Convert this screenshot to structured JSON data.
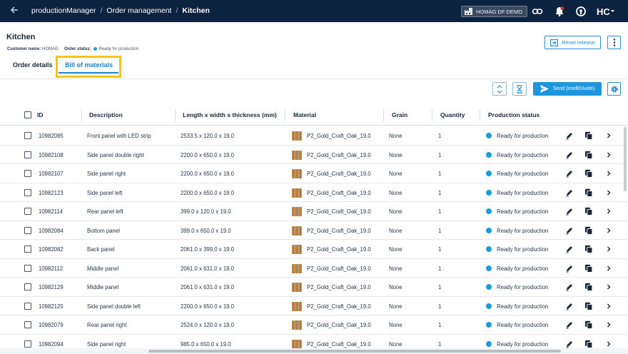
{
  "topbar": {
    "breadcrumbs": [
      "productionManager",
      "Order management",
      "Kitchen"
    ],
    "environment": "HOMAG DF DEMO",
    "icons": [
      "back-arrow-icon",
      "factory-icon",
      "link-icon",
      "notifications-icon",
      "support-icon",
      "user-menu-icon"
    ]
  },
  "page": {
    "title": "Kitchen",
    "customer_label": "Customer name:",
    "customer_value": "HOMAG",
    "status_label": "Order status:",
    "status_value": "Ready for production",
    "reset_label": "Reset release"
  },
  "tabs": [
    {
      "label": "Order details",
      "active": false
    },
    {
      "label": "Bill of materials",
      "active": true
    }
  ],
  "toolbar": {
    "send_label": "Send (intelliDivide)"
  },
  "table": {
    "columns": [
      "ID",
      "Description",
      "Length x width x thickness (mm)",
      "Material",
      "Grain",
      "Quantity",
      "Production status"
    ],
    "rows": [
      {
        "id": "10982085",
        "description": "Front panel with LED strip",
        "dims": "2533.5 x 120.0 x 19.0",
        "material": "P2_Gold_Craft_Oak_19.0",
        "grain": "None",
        "qty": "1",
        "status": "Ready for production"
      },
      {
        "id": "10982108",
        "description": "Side panel double right",
        "dims": "2200.0 x 650.0 x 19.0",
        "material": "P2_Gold_Craft_Oak_19.0",
        "grain": "None",
        "qty": "1",
        "status": "Ready for production"
      },
      {
        "id": "10982107",
        "description": "Side panel right",
        "dims": "2200.0 x 650.0 x 19.0",
        "material": "P2_Gold_Craft_Oak_19.0",
        "grain": "None",
        "qty": "1",
        "status": "Ready for production"
      },
      {
        "id": "10982123",
        "description": "Side panel left",
        "dims": "2200.0 x 650.0 x 19.0",
        "material": "P2_Gold_Craft_Oak_19.0",
        "grain": "None",
        "qty": "1",
        "status": "Ready for production"
      },
      {
        "id": "10982114",
        "description": "Rear panel left",
        "dims": "399.0 x 120.0 x 19.0",
        "material": "P2_Gold_Craft_Oak_19.0",
        "grain": "None",
        "qty": "1",
        "status": "Ready for production"
      },
      {
        "id": "10982084",
        "description": "Bottom panel",
        "dims": "399.0 x 650.0 x 19.0",
        "material": "P2_Gold_Craft_Oak_19.0",
        "grain": "None",
        "qty": "1",
        "status": "Ready for production"
      },
      {
        "id": "10982082",
        "description": "Back panel",
        "dims": "2061.0 x 399.0 x 19.0",
        "material": "P2_Gold_Craft_Oak_19.0",
        "grain": "None",
        "qty": "1",
        "status": "Ready for production"
      },
      {
        "id": "10982112",
        "description": "Middle panel",
        "dims": "2061.0 x 631.0 x 19.0",
        "material": "P2_Gold_Craft_Oak_19.0",
        "grain": "None",
        "qty": "1",
        "status": "Ready for production"
      },
      {
        "id": "10982129",
        "description": "Middle panel",
        "dims": "2061.0 x 631.0 x 19.0",
        "material": "P2_Gold_Craft_Oak_19.0",
        "grain": "None",
        "qty": "1",
        "status": "Ready for production"
      },
      {
        "id": "10982125",
        "description": "Side panel double left",
        "dims": "2200.0 x 650.0 x 19.0",
        "material": "P2_Gold_Craft_Oak_19.0",
        "grain": "None",
        "qty": "1",
        "status": "Ready for production"
      },
      {
        "id": "10982079",
        "description": "Rear panel right",
        "dims": "2524.0 x 120.0 x 19.0",
        "material": "P2_Gold_Craft_Oak_19.0",
        "grain": "None",
        "qty": "1",
        "status": "Ready for production"
      },
      {
        "id": "10982094",
        "description": "Side panel right",
        "dims": "985.0 x 650.0 x 19.0",
        "material": "P2_Gold_Craft_Oak_19.0",
        "grain": "None",
        "qty": "1",
        "status": "Ready for production"
      }
    ]
  },
  "colors": {
    "topbar": "#0c2340",
    "accent": "#1e84cc",
    "highlight": "#f4c418",
    "status_ready": "#1a9de0"
  }
}
